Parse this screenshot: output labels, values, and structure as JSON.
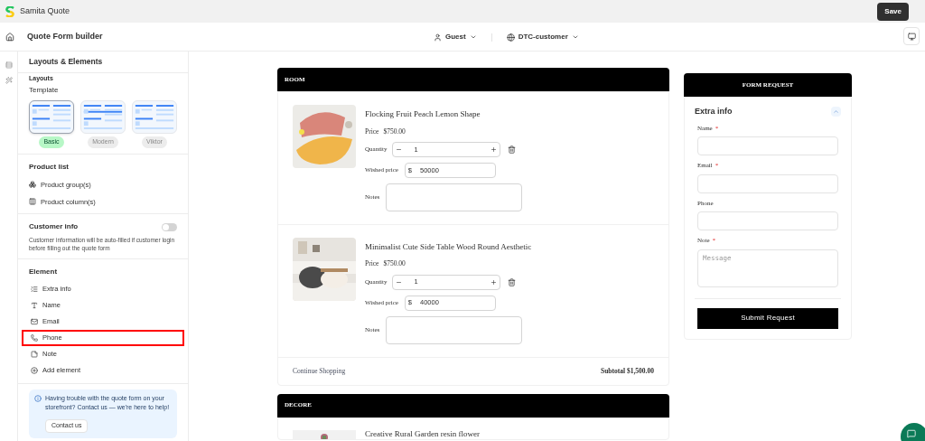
{
  "app": {
    "title": "Samita Quote",
    "save": "Save"
  },
  "header": {
    "title": "Quote Form builder",
    "customer": "Guest",
    "segment": "DTC-customer"
  },
  "sidebar": {
    "title": "Layouts & Elements",
    "cut_heading": "Layouts",
    "template_label": "Template",
    "templates": [
      {
        "label": "Basic",
        "selected": true
      },
      {
        "label": "Modern",
        "selected": false
      },
      {
        "label": "Viktor",
        "selected": false
      }
    ],
    "product_list": {
      "title": "Product list",
      "items": [
        "Product group(s)",
        "Product column(s)"
      ]
    },
    "customer_info": {
      "title": "Customer info",
      "on": false,
      "description": "Customer information will be auto-filled if customer login before filling out the quote form"
    },
    "element": {
      "title": "Element",
      "items": [
        {
          "kind": "extra",
          "label": "Extra info",
          "highlighted": false
        },
        {
          "kind": "name",
          "label": "Name",
          "highlighted": false
        },
        {
          "kind": "email",
          "label": "Email",
          "highlighted": false
        },
        {
          "kind": "phone",
          "label": "Phone",
          "highlighted": true
        },
        {
          "kind": "note",
          "label": "Note",
          "highlighted": false
        },
        {
          "kind": "add",
          "label": "Add element",
          "highlighted": false
        }
      ]
    },
    "help": {
      "text": "Having trouble with the quote form on your storefront? Contact us — we're here to help!",
      "button": "Contact us"
    }
  },
  "groups": [
    {
      "title": "ROOM",
      "products": [
        {
          "name": "Flocking Fruit Peach Lemon Shape",
          "price_label": "Price",
          "price": "$750.00",
          "quantity_label": "Quantity",
          "quantity": "1",
          "wished_label": "Wished price",
          "currency": "$",
          "wished": "50000",
          "notes_label": "Notes"
        },
        {
          "name": "Minimalist Cute Side Table Wood Round Aesthetic",
          "price_label": "Price",
          "price": "$750.00",
          "quantity_label": "Quantity",
          "quantity": "1",
          "wished_label": "Wished price",
          "currency": "$",
          "wished": "40000",
          "notes_label": "Notes"
        }
      ],
      "continue": "Continue Shopping",
      "subtotal": "Subtotal $1,500.00"
    },
    {
      "title": "DECORE",
      "products": [
        {
          "name": "Creative Rural Garden resin flower"
        }
      ]
    }
  ],
  "form": {
    "title": "FORM REQUEST",
    "section": "Extra info",
    "expanded": true,
    "fields": [
      {
        "kind": "input",
        "label": "Name",
        "required_mark": "*"
      },
      {
        "kind": "input",
        "label": "Email",
        "required_mark": "*"
      },
      {
        "kind": "input",
        "label": "Phone"
      },
      {
        "kind": "textarea",
        "label": "Note",
        "required_mark": "*",
        "placeholder": "Message"
      }
    ],
    "submit": "Submit Request"
  }
}
